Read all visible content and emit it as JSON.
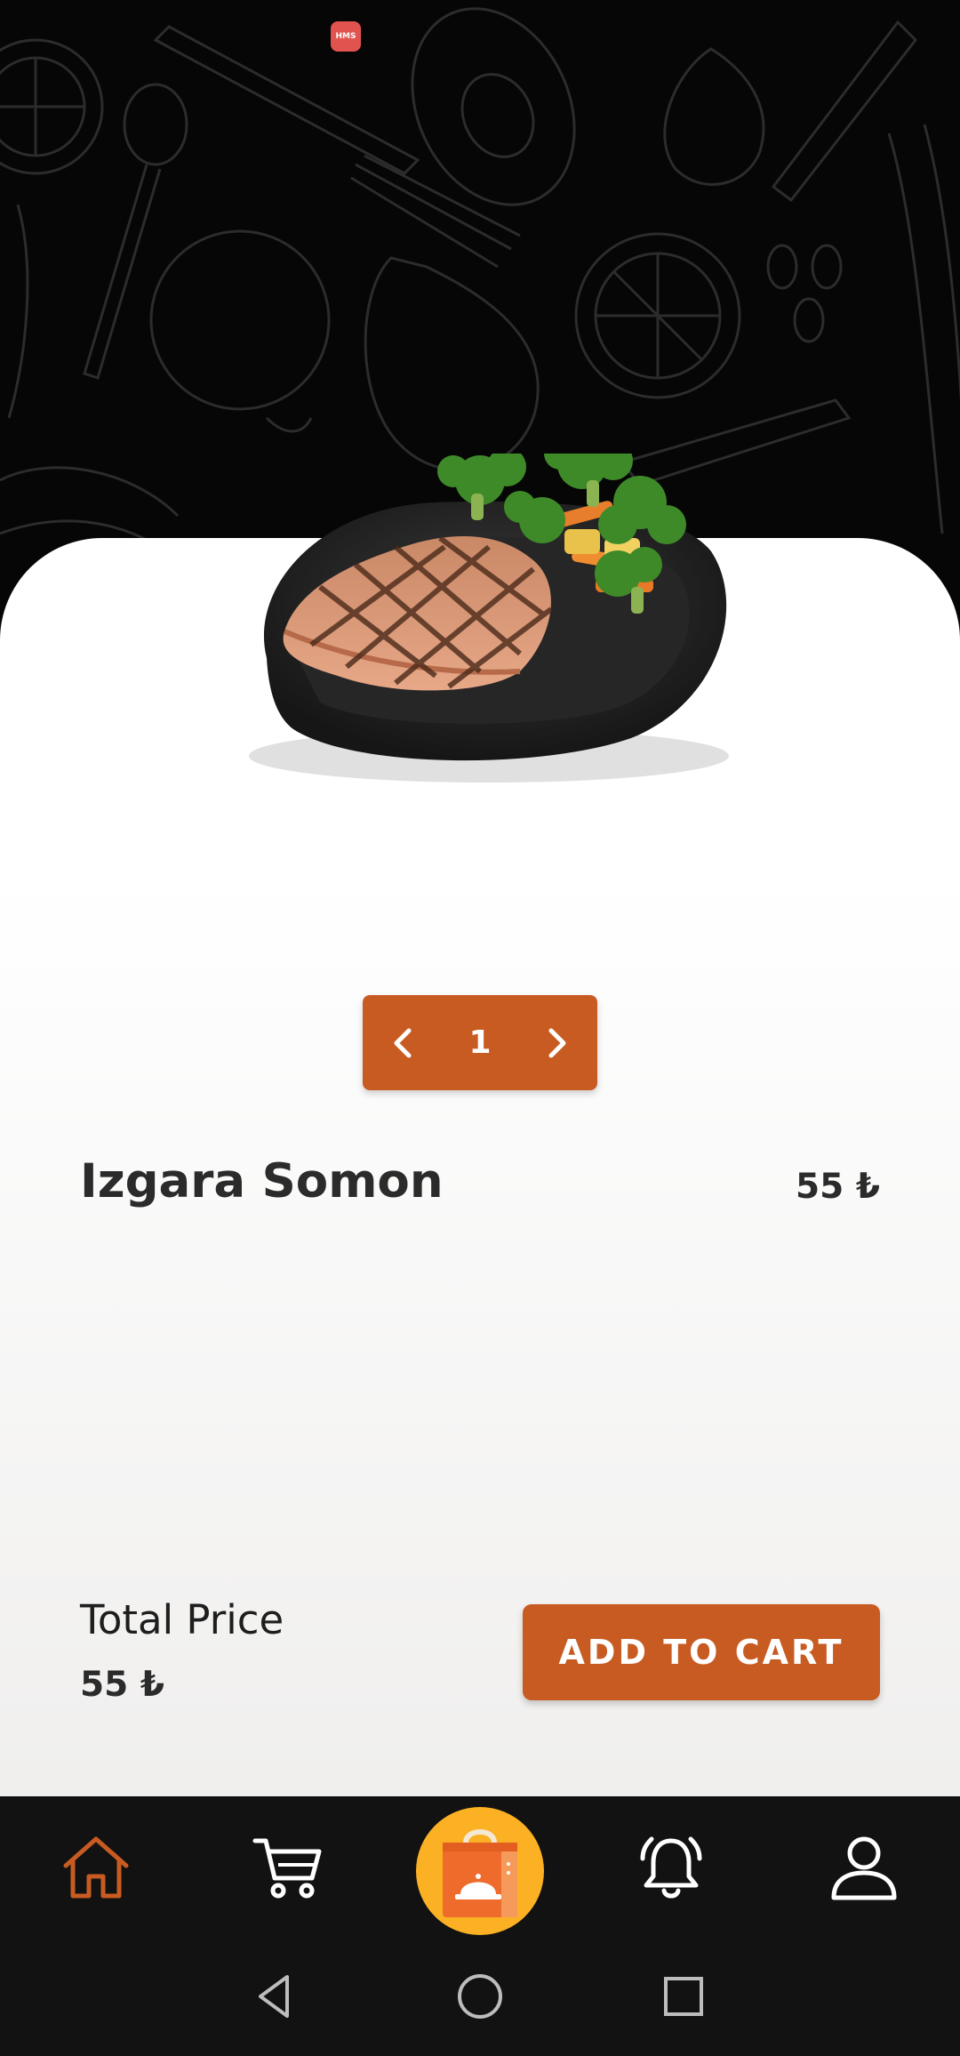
{
  "status_bar": {
    "time": "",
    "right_text": "",
    "hms_badge": "HMS"
  },
  "product": {
    "name": "Izgara Somon",
    "price": "55 ₺",
    "image": "grilled-salmon-plate"
  },
  "stepper": {
    "quantity": "1",
    "prev_icon": "chevron-left-icon",
    "next_icon": "chevron-right-icon"
  },
  "footer": {
    "total_label": "Total Price",
    "total_value": "55 ₺",
    "add_to_cart_label": "ADD TO CART"
  },
  "bottom_nav": {
    "items": [
      {
        "name": "home",
        "icon": "home-icon",
        "active": true
      },
      {
        "name": "cart",
        "icon": "cart-icon",
        "active": false
      },
      {
        "name": "orders",
        "icon": "shopping-bag-icon",
        "active": false
      },
      {
        "name": "notifications",
        "icon": "bell-icon",
        "active": false
      },
      {
        "name": "profile",
        "icon": "user-icon",
        "active": false
      }
    ]
  },
  "colors": {
    "accent": "#c85b22",
    "center_button": "#fbb123",
    "nav_background": "#121212",
    "hero_background": "#060606",
    "text_dark": "#2b2b2b"
  }
}
